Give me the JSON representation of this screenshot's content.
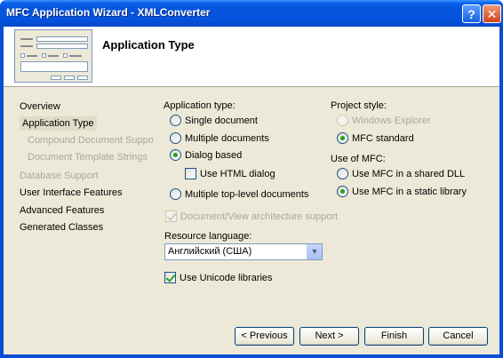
{
  "window": {
    "title": "MFC Application Wizard - XMLConverter",
    "help_label": "?",
    "close_label": "✕"
  },
  "header": {
    "title": "Application Type"
  },
  "nav": {
    "items": [
      {
        "label": "Overview"
      },
      {
        "label": "Application Type"
      },
      {
        "label": "Compound Document Support"
      },
      {
        "label": "Document Template Strings"
      },
      {
        "label": "Database Support"
      },
      {
        "label": "User Interface Features"
      },
      {
        "label": "Advanced Features"
      },
      {
        "label": "Generated Classes"
      }
    ]
  },
  "app_type": {
    "label": "Application type:",
    "options": [
      {
        "label": "Single document",
        "selected": false
      },
      {
        "label": "Multiple documents",
        "selected": false
      },
      {
        "label": "Dialog based",
        "selected": true
      },
      {
        "label": "Multiple top-level documents",
        "selected": false
      }
    ],
    "html_dialog": {
      "label": "Use HTML dialog",
      "checked": false
    },
    "docview": {
      "label": "Document/View architecture support",
      "checked": true,
      "enabled": false
    }
  },
  "project_style": {
    "label": "Project style:",
    "options": [
      {
        "label": "Windows Explorer",
        "selected": false,
        "enabled": false
      },
      {
        "label": "MFC standard",
        "selected": true
      }
    ]
  },
  "use_mfc": {
    "label": "Use of MFC:",
    "options": [
      {
        "label": "Use MFC in a shared DLL",
        "selected": false
      },
      {
        "label": "Use MFC in a static library",
        "selected": true
      }
    ]
  },
  "resource_language": {
    "label": "Resource language:",
    "value": "Английский (США)"
  },
  "unicode": {
    "label": "Use Unicode libraries",
    "checked": true
  },
  "buttons": {
    "previous": "< Previous",
    "next": "Next >",
    "finish": "Finish",
    "cancel": "Cancel"
  }
}
